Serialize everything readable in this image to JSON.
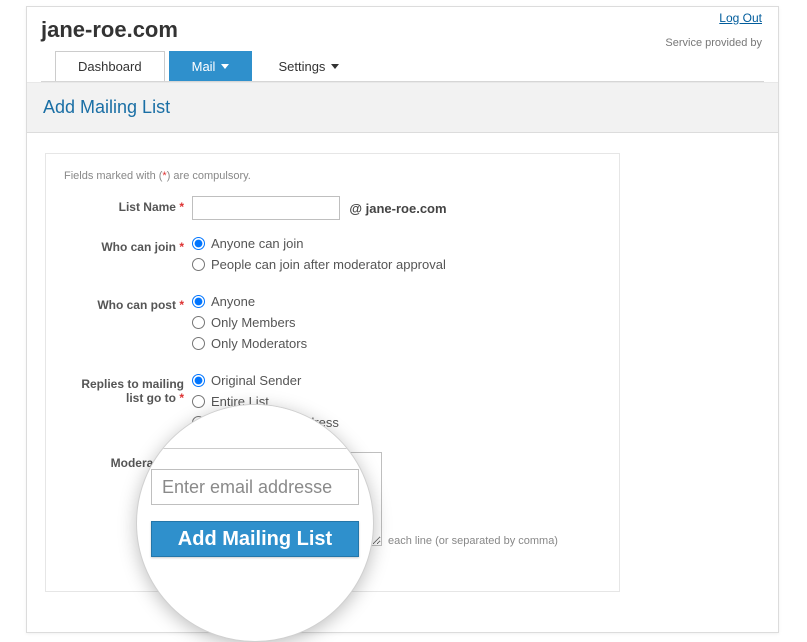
{
  "header": {
    "domain": "jane-roe.com",
    "logout": "Log Out",
    "service": "Service provided by"
  },
  "tabs": {
    "dashboard": "Dashboard",
    "mail": "Mail",
    "settings": "Settings"
  },
  "page": {
    "title": "Add Mailing List",
    "compulsory_prefix": "Fields marked with (",
    "compulsory_ast": "*",
    "compulsory_suffix": ") are compulsory."
  },
  "form": {
    "list_name": {
      "label": "List Name",
      "value": "",
      "suffix": "@ jane-roe.com"
    },
    "who_can_join": {
      "label": "Who can join",
      "opts": [
        "Anyone can join",
        "People can join after moderator approval"
      ]
    },
    "who_can_post": {
      "label": "Who can post",
      "opts": [
        "Anyone",
        "Only Members",
        "Only Moderators"
      ]
    },
    "replies_to": {
      "label_line1": "Replies to mailing",
      "label_line2": "list go to",
      "opts": [
        "Original Sender",
        "Entire List",
        "Specific Emailaddress"
      ]
    },
    "moderators": {
      "label": "Moderators",
      "value": "",
      "hint_tail": "each line (or separated by comma)"
    }
  },
  "lens": {
    "placeholder": "Enter email addresse",
    "button": "Add Mailing List"
  }
}
